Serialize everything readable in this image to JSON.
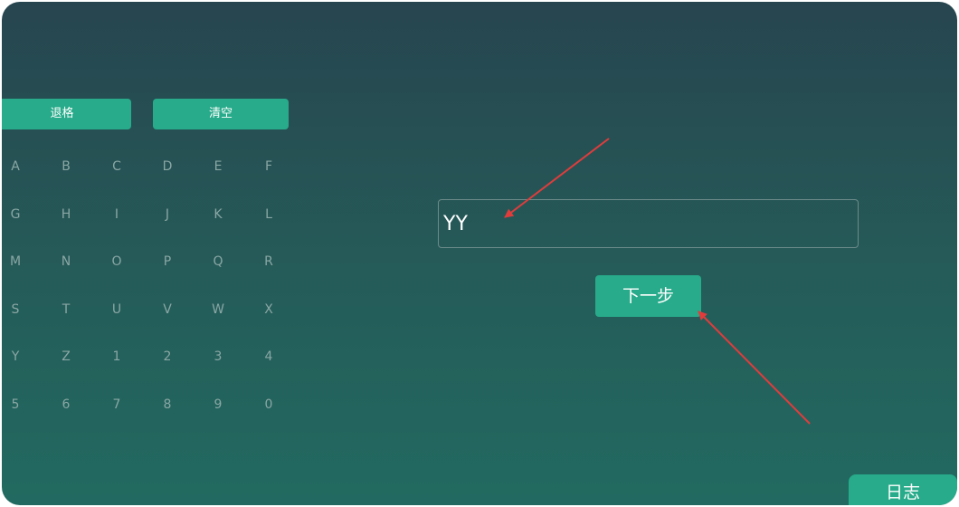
{
  "keyboard": {
    "backspace_label": "退格",
    "clear_label": "清空",
    "keys": [
      "A",
      "B",
      "C",
      "D",
      "E",
      "F",
      "G",
      "H",
      "I",
      "J",
      "K",
      "L",
      "M",
      "N",
      "O",
      "P",
      "Q",
      "R",
      "S",
      "T",
      "U",
      "V",
      "W",
      "X",
      "Y",
      "Z",
      "1",
      "2",
      "3",
      "4",
      "5",
      "6",
      "7",
      "8",
      "9",
      "0"
    ]
  },
  "input": {
    "value": "YY"
  },
  "next_button": {
    "label": "下一步"
  },
  "log_button": {
    "label": "日志"
  },
  "colors": {
    "accent": "#27ab8a",
    "annotation_arrow": "#e03c3c",
    "background_top": "#27454f",
    "background_bottom": "#226a61"
  }
}
